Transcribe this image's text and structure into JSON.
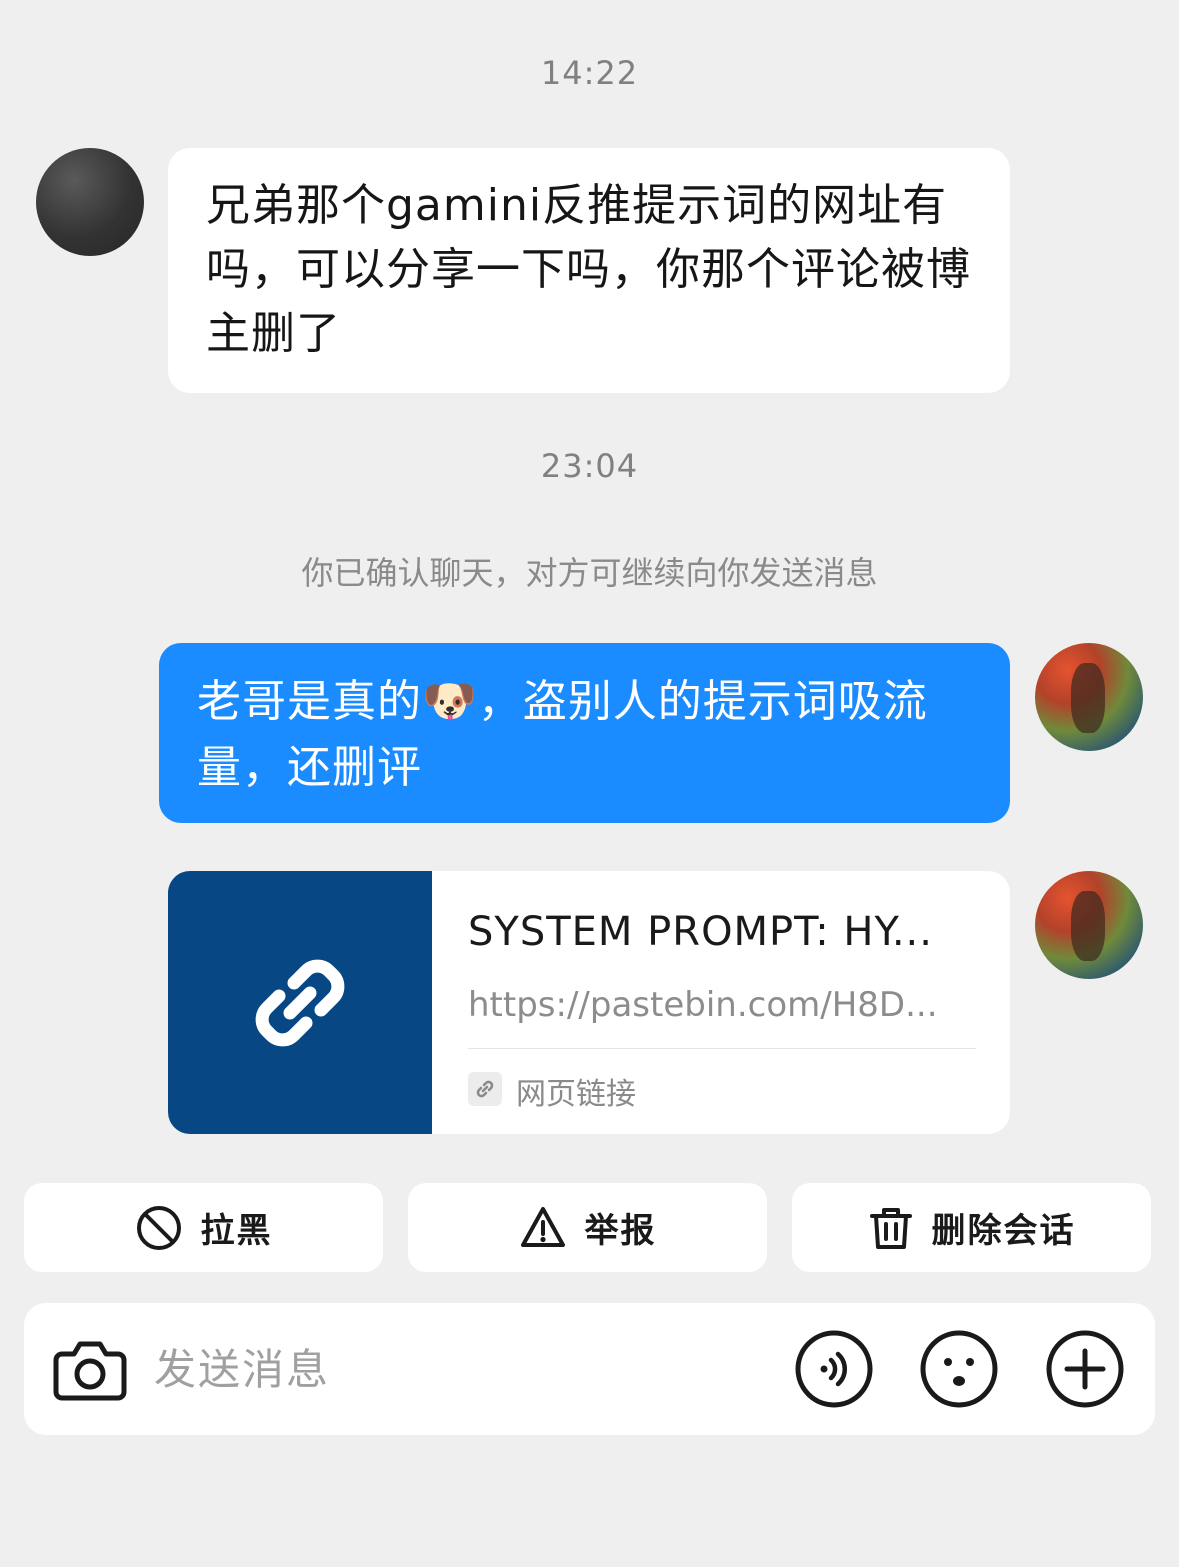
{
  "chat": {
    "timestamp_1": "14:22",
    "incoming_message": "兄弟那个gamini反推提示词的网址有吗，可以分享一下吗，你那个评论被博主删了",
    "timestamp_2": "23:04",
    "system_note": "你已确认聊天，对方可继续向你发送消息",
    "outgoing_message": "老哥是真的🐶，盗别人的提示词吸流量，还删评",
    "link_card": {
      "title": "SYSTEM PROMPT: HY...",
      "url": "https://pastebin.com/H8D...",
      "source_label": "网页链接",
      "thumb_icon": "link-icon",
      "thumb_color": "#064784"
    }
  },
  "actions": {
    "block_label": "拉黑",
    "block_icon": "block-icon",
    "report_label": "举报",
    "report_icon": "warning-icon",
    "delete_label": "删除会话",
    "delete_icon": "trash-icon"
  },
  "composer": {
    "placeholder": "发送消息",
    "camera_icon": "camera-icon",
    "voice_icon": "voice-icon",
    "emoji_icon": "emoji-icon",
    "add_icon": "plus-icon"
  },
  "colors": {
    "background": "#efefef",
    "outgoing_bubble": "#1b8cff",
    "incoming_bubble": "#ffffff"
  }
}
